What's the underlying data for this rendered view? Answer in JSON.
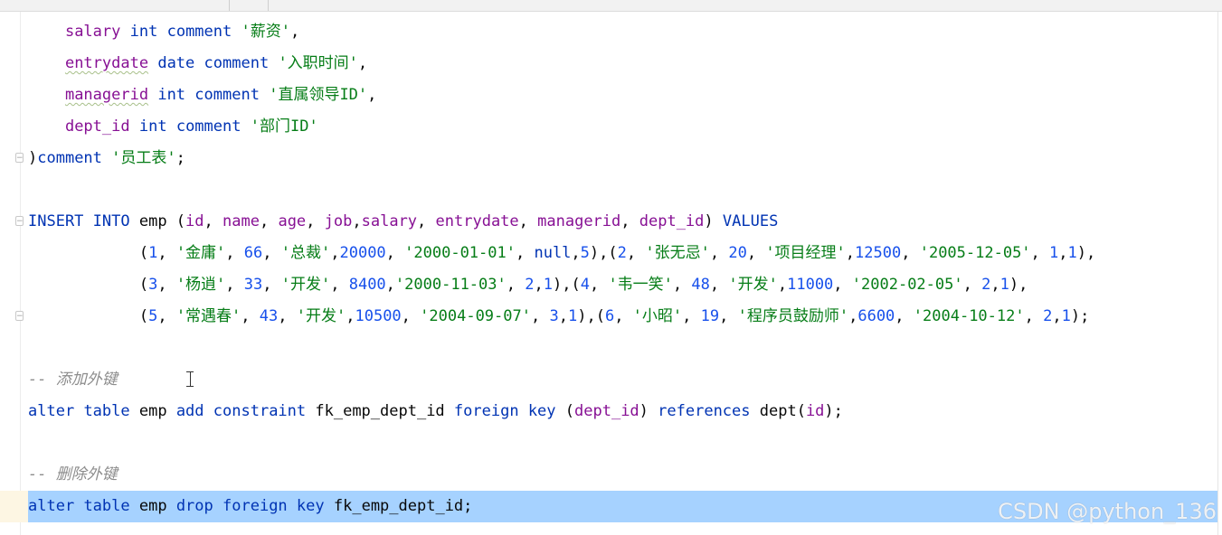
{
  "editor": {
    "lines": [
      {
        "indent": "    ",
        "tokens": [
          [
            "col",
            "salary"
          ],
          [
            "tx",
            " "
          ],
          [
            "kw",
            "int"
          ],
          [
            "tx",
            " "
          ],
          [
            "kw",
            "comment"
          ],
          [
            "tx",
            " "
          ],
          [
            "str",
            "'薪资'"
          ],
          [
            "tx",
            ","
          ]
        ]
      },
      {
        "indent": "    ",
        "tokens": [
          [
            "col-w",
            "entrydate"
          ],
          [
            "tx",
            " "
          ],
          [
            "kw",
            "date"
          ],
          [
            "tx",
            " "
          ],
          [
            "kw",
            "comment"
          ],
          [
            "tx",
            " "
          ],
          [
            "str",
            "'入职时间'"
          ],
          [
            "tx",
            ","
          ]
        ]
      },
      {
        "indent": "    ",
        "tokens": [
          [
            "col-w",
            "managerid"
          ],
          [
            "tx",
            " "
          ],
          [
            "kw",
            "int"
          ],
          [
            "tx",
            " "
          ],
          [
            "kw",
            "comment"
          ],
          [
            "tx",
            " "
          ],
          [
            "str",
            "'直属领导ID'"
          ],
          [
            "tx",
            ","
          ]
        ]
      },
      {
        "indent": "    ",
        "tokens": [
          [
            "col",
            "dept_id"
          ],
          [
            "tx",
            " "
          ],
          [
            "kw",
            "int"
          ],
          [
            "tx",
            " "
          ],
          [
            "kw",
            "comment"
          ],
          [
            "tx",
            " "
          ],
          [
            "str",
            "'部门ID'"
          ]
        ]
      },
      {
        "indent": "",
        "fold": true,
        "tokens": [
          [
            "tx",
            ")"
          ],
          [
            "kw",
            "comment"
          ],
          [
            "tx",
            " "
          ],
          [
            "str",
            "'员工表'"
          ],
          [
            "tx",
            ";"
          ]
        ]
      },
      {
        "indent": "",
        "tokens": []
      },
      {
        "indent": "",
        "fold": true,
        "tokens": [
          [
            "kw",
            "INSERT"
          ],
          [
            "tx",
            " "
          ],
          [
            "kw",
            "INTO"
          ],
          [
            "tx",
            " emp ("
          ],
          [
            "col",
            "id"
          ],
          [
            "tx",
            ", "
          ],
          [
            "col",
            "name"
          ],
          [
            "tx",
            ", "
          ],
          [
            "col",
            "age"
          ],
          [
            "tx",
            ", "
          ],
          [
            "col",
            "job"
          ],
          [
            "tx",
            ","
          ],
          [
            "col",
            "salary"
          ],
          [
            "tx",
            ", "
          ],
          [
            "col",
            "entrydate"
          ],
          [
            "tx",
            ", "
          ],
          [
            "col",
            "managerid"
          ],
          [
            "tx",
            ", "
          ],
          [
            "col",
            "dept_id"
          ],
          [
            "tx",
            ") "
          ],
          [
            "kw",
            "VALUES"
          ]
        ]
      },
      {
        "indent": "            ",
        "tokens": [
          [
            "tx",
            "("
          ],
          [
            "num",
            "1"
          ],
          [
            "tx",
            ", "
          ],
          [
            "str",
            "'金庸'"
          ],
          [
            "tx",
            ", "
          ],
          [
            "num",
            "66"
          ],
          [
            "tx",
            ", "
          ],
          [
            "str",
            "'总裁'"
          ],
          [
            "tx",
            ","
          ],
          [
            "num",
            "20000"
          ],
          [
            "tx",
            ", "
          ],
          [
            "str",
            "'2000-01-01'"
          ],
          [
            "tx",
            ", "
          ],
          [
            "kw",
            "null"
          ],
          [
            "tx",
            ","
          ],
          [
            "num",
            "5"
          ],
          [
            "tx",
            "),("
          ],
          [
            "num",
            "2"
          ],
          [
            "tx",
            ", "
          ],
          [
            "str",
            "'张无忌'"
          ],
          [
            "tx",
            ", "
          ],
          [
            "num",
            "20"
          ],
          [
            "tx",
            ", "
          ],
          [
            "str",
            "'项目经理'"
          ],
          [
            "tx",
            ","
          ],
          [
            "num",
            "12500"
          ],
          [
            "tx",
            ", "
          ],
          [
            "str",
            "'2005-12-05'"
          ],
          [
            "tx",
            ", "
          ],
          [
            "num",
            "1"
          ],
          [
            "tx",
            ","
          ],
          [
            "num",
            "1"
          ],
          [
            "tx",
            "),"
          ]
        ]
      },
      {
        "indent": "            ",
        "tokens": [
          [
            "tx",
            "("
          ],
          [
            "num",
            "3"
          ],
          [
            "tx",
            ", "
          ],
          [
            "str",
            "'杨逍'"
          ],
          [
            "tx",
            ", "
          ],
          [
            "num",
            "33"
          ],
          [
            "tx",
            ", "
          ],
          [
            "str",
            "'开发'"
          ],
          [
            "tx",
            ", "
          ],
          [
            "num",
            "8400"
          ],
          [
            "tx",
            ","
          ],
          [
            "str",
            "'2000-11-03'"
          ],
          [
            "tx",
            ", "
          ],
          [
            "num",
            "2"
          ],
          [
            "tx",
            ","
          ],
          [
            "num",
            "1"
          ],
          [
            "tx",
            "),("
          ],
          [
            "num",
            "4"
          ],
          [
            "tx",
            ", "
          ],
          [
            "str",
            "'韦一笑'"
          ],
          [
            "tx",
            ", "
          ],
          [
            "num",
            "48"
          ],
          [
            "tx",
            ", "
          ],
          [
            "str",
            "'开发'"
          ],
          [
            "tx",
            ","
          ],
          [
            "num",
            "11000"
          ],
          [
            "tx",
            ", "
          ],
          [
            "str",
            "'2002-02-05'"
          ],
          [
            "tx",
            ", "
          ],
          [
            "num",
            "2"
          ],
          [
            "tx",
            ","
          ],
          [
            "num",
            "1"
          ],
          [
            "tx",
            "),"
          ]
        ]
      },
      {
        "indent": "            ",
        "fold": true,
        "tokens": [
          [
            "tx",
            "("
          ],
          [
            "num",
            "5"
          ],
          [
            "tx",
            ", "
          ],
          [
            "str",
            "'常遇春'"
          ],
          [
            "tx",
            ", "
          ],
          [
            "num",
            "43"
          ],
          [
            "tx",
            ", "
          ],
          [
            "str",
            "'开发'"
          ],
          [
            "tx",
            ","
          ],
          [
            "num",
            "10500"
          ],
          [
            "tx",
            ", "
          ],
          [
            "str",
            "'2004-09-07'"
          ],
          [
            "tx",
            ", "
          ],
          [
            "num",
            "3"
          ],
          [
            "tx",
            ","
          ],
          [
            "num",
            "1"
          ],
          [
            "tx",
            "),("
          ],
          [
            "num",
            "6"
          ],
          [
            "tx",
            ", "
          ],
          [
            "str",
            "'小昭'"
          ],
          [
            "tx",
            ", "
          ],
          [
            "num",
            "19"
          ],
          [
            "tx",
            ", "
          ],
          [
            "str",
            "'程序员鼓励师'"
          ],
          [
            "tx",
            ","
          ],
          [
            "num",
            "6600"
          ],
          [
            "tx",
            ", "
          ],
          [
            "str",
            "'2004-10-12'"
          ],
          [
            "tx",
            ", "
          ],
          [
            "num",
            "2"
          ],
          [
            "tx",
            ","
          ],
          [
            "num",
            "1"
          ],
          [
            "tx",
            ");"
          ]
        ]
      },
      {
        "indent": "",
        "tokens": []
      },
      {
        "indent": "",
        "tokens": [
          [
            "cmt",
            "-- 添加外键"
          ]
        ]
      },
      {
        "indent": "",
        "tokens": [
          [
            "kw",
            "alter"
          ],
          [
            "tx",
            " "
          ],
          [
            "kw",
            "table"
          ],
          [
            "tx",
            " emp "
          ],
          [
            "kw",
            "add"
          ],
          [
            "tx",
            " "
          ],
          [
            "kw",
            "constraint"
          ],
          [
            "tx",
            " fk_emp_dept_id "
          ],
          [
            "kw",
            "foreign"
          ],
          [
            "tx",
            " "
          ],
          [
            "kw",
            "key"
          ],
          [
            "tx",
            " ("
          ],
          [
            "col",
            "dept_id"
          ],
          [
            "tx",
            ") "
          ],
          [
            "kw",
            "references"
          ],
          [
            "tx",
            " dept("
          ],
          [
            "col",
            "id"
          ],
          [
            "tx",
            ");"
          ]
        ]
      },
      {
        "indent": "",
        "tokens": []
      },
      {
        "indent": "",
        "tokens": [
          [
            "cmt",
            "-- 删除外键"
          ]
        ]
      },
      {
        "indent": "",
        "selected": true,
        "tokens": [
          [
            "kw",
            "alter"
          ],
          [
            "tx",
            " "
          ],
          [
            "kw",
            "table"
          ],
          [
            "tx",
            " emp "
          ],
          [
            "kw",
            "drop"
          ],
          [
            "tx",
            " "
          ],
          [
            "kw",
            "foreign"
          ],
          [
            "tx",
            " "
          ],
          [
            "kw",
            "key"
          ],
          [
            "tx",
            " fk_emp_dept_id;"
          ]
        ]
      }
    ]
  },
  "watermark": "CSDN @python_136"
}
